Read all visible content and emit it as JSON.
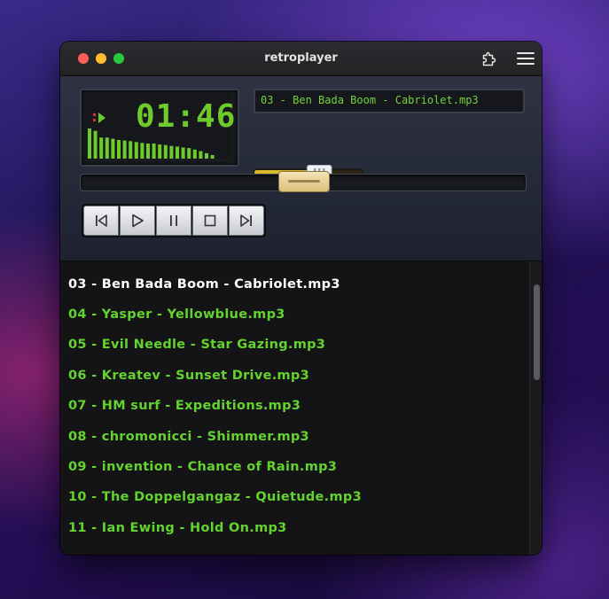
{
  "window": {
    "title": "retroplayer"
  },
  "display": {
    "time": "01:46"
  },
  "now_playing": "03 - Ben Bada Boom - Cabriolet.mp3",
  "volume_level": 0.6,
  "seek_position": 0.5,
  "spectrum_levels": [
    1.0,
    0.92,
    0.7,
    0.7,
    0.66,
    0.62,
    0.6,
    0.58,
    0.55,
    0.52,
    0.5,
    0.5,
    0.47,
    0.45,
    0.42,
    0.4,
    0.37,
    0.35,
    0.3,
    0.25,
    0.18,
    0.12
  ],
  "controls": [
    "previous",
    "play",
    "pause",
    "stop",
    "next"
  ],
  "playlist": {
    "current_index": 0,
    "items": [
      "03 - Ben Bada Boom - Cabriolet.mp3",
      "04 - Yasper - Yellowblue.mp3",
      "05 - Evil Needle - Star Gazing.mp3",
      "06 - Kreatev - Sunset Drive.mp3",
      "07 - HM surf - Expeditions.mp3",
      "08 - chromonicci - Shimmer.mp3",
      "09 - invention - Chance of Rain.mp3",
      "10 - The Doppelgangaz - Quietude.mp3",
      "11 - Ian Ewing - Hold On.mp3"
    ]
  },
  "colors": {
    "accent_green": "#63d32f",
    "current_track": "#ffffff",
    "seek_thumb": "#e8d29a",
    "volume_bar": "#d8b92a"
  }
}
